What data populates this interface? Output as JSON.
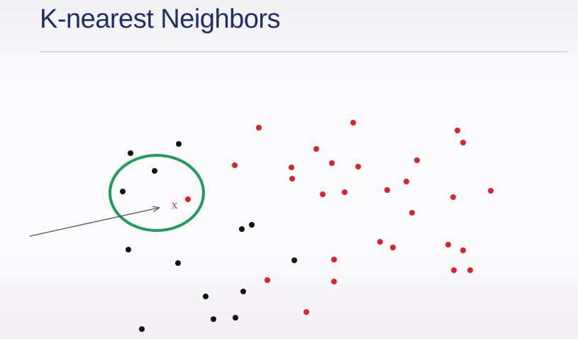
{
  "slide": {
    "title": "K-nearest Neighbors",
    "title_color": "#1f2f6b"
  },
  "diagram": {
    "query_label": "x",
    "query_color": "#b03aa8",
    "circle_color": "#1e9e5a",
    "arrow_color": "#555555",
    "class_colors": {
      "black": "#111111",
      "red": "#e11f2b"
    },
    "point_classes": [
      "black",
      "black",
      "black",
      "black",
      "red",
      "black",
      "black",
      "black",
      "black",
      "black",
      "black",
      "black",
      "black",
      "black",
      "black",
      "red",
      "red",
      "red",
      "red",
      "red",
      "red",
      "red",
      "red",
      "red",
      "red",
      "red",
      "red",
      "red",
      "red",
      "red",
      "red",
      "red",
      "red",
      "red",
      "red",
      "red",
      "red",
      "red",
      "red",
      "red",
      "red",
      "red",
      "red"
    ]
  }
}
